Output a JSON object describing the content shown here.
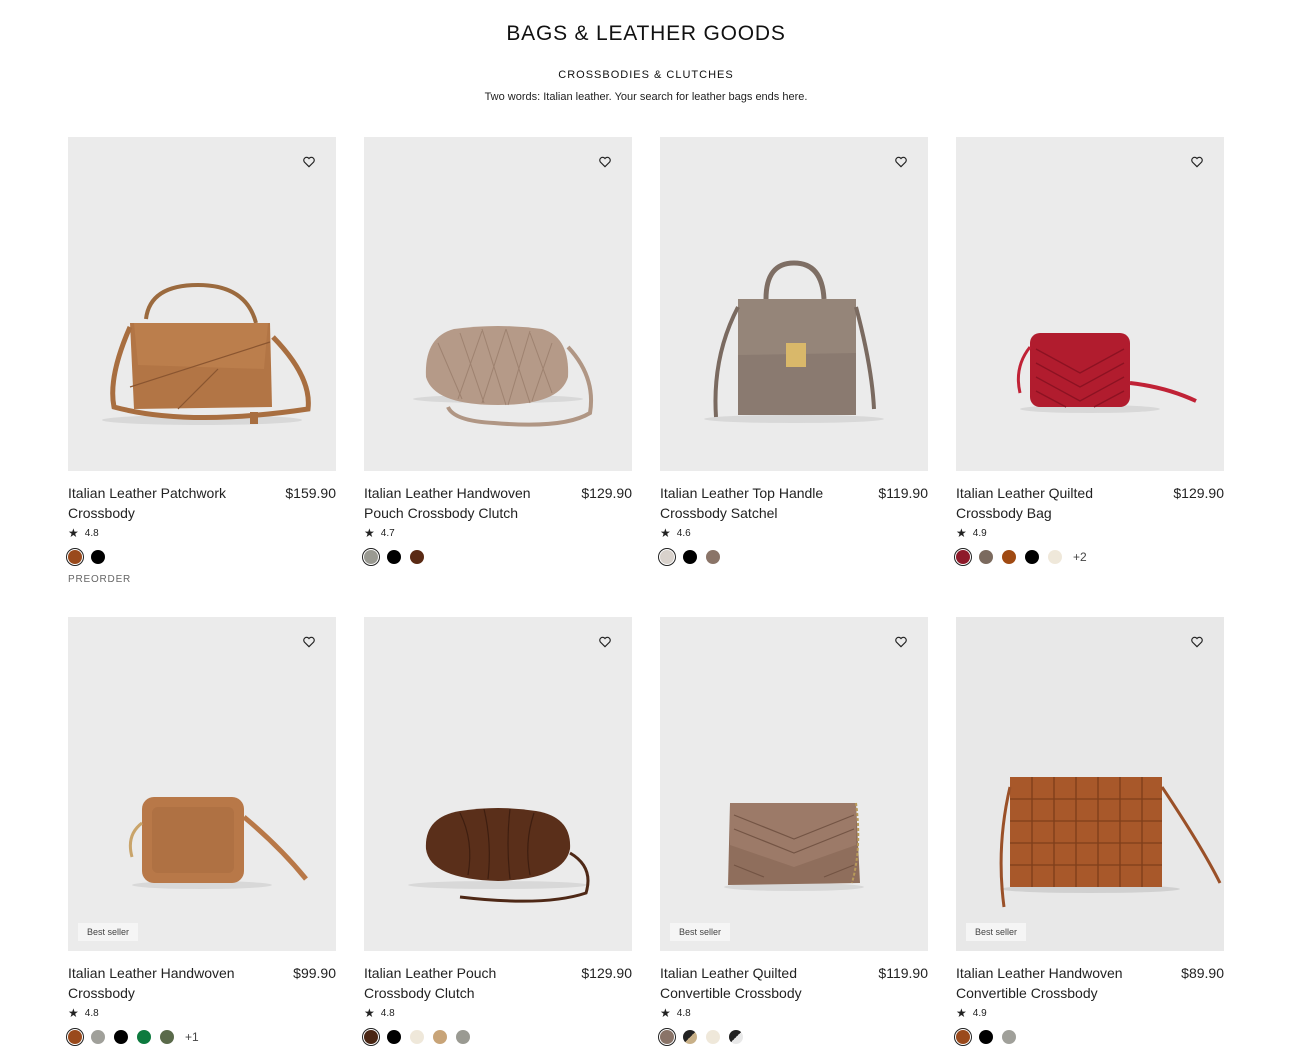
{
  "header": {
    "title": "BAGS & LEATHER GOODS",
    "subtitle": "CROSSBODIES & CLUTCHES",
    "description": "Two words: Italian leather. Your search for leather bags ends here."
  },
  "products": [
    {
      "name": "Italian Leather Patchwork Crossbody",
      "price": "$159.90",
      "rating": "4.8",
      "badge": "",
      "status": "PREORDER",
      "swatches": [
        "#9a4a1c",
        "#000000"
      ],
      "more": ""
    },
    {
      "name": "Italian Leather Handwoven Pouch Crossbody Clutch",
      "price": "$129.90",
      "rating": "4.7",
      "badge": "",
      "status": "",
      "swatches": [
        "#9a9a92",
        "#000000",
        "#5a2a14"
      ],
      "more": ""
    },
    {
      "name": "Italian Leather Top Handle Crossbody Satchel",
      "price": "$119.90",
      "rating": "4.6",
      "badge": "",
      "status": "",
      "swatches": [
        "#d9d2cc",
        "#000000",
        "#8a7468"
      ],
      "more": ""
    },
    {
      "name": "Italian Leather Quilted Crossbody Bag",
      "price": "$129.90",
      "rating": "4.9",
      "badge": "",
      "status": "",
      "swatches": [
        "#8e1a2a",
        "#7b6a5e",
        "#a04a12",
        "#000000",
        "#efe8da"
      ],
      "more": "+2"
    },
    {
      "name": "Italian Leather Handwoven Crossbody",
      "price": "$99.90",
      "rating": "4.8",
      "badge": "Best seller",
      "status": "",
      "swatches": [
        "#9a4a1c",
        "#a0a09a",
        "#000000",
        "#0d7a3e",
        "#5a6a4a"
      ],
      "more": "+1"
    },
    {
      "name": "Italian Leather Pouch Crossbody Clutch",
      "price": "$129.90",
      "rating": "4.8",
      "badge": "",
      "status": "",
      "swatches": [
        "#4a2614",
        "#000000",
        "#efe8da",
        "#c8a478",
        "#9a9a92"
      ],
      "more": ""
    },
    {
      "name": "Italian Leather Quilted Convertible Crossbody",
      "price": "$119.90",
      "rating": "4.8",
      "badge": "Best seller",
      "status": "",
      "swatches": [
        "#8a7468",
        "#c8b088",
        "#efe8da",
        "#222222"
      ],
      "more": ""
    },
    {
      "name": "Italian Leather Handwoven Convertible Crossbody",
      "price": "$89.90",
      "rating": "4.9",
      "badge": "Best seller",
      "status": "",
      "swatches": [
        "#9a4a1c",
        "#000000",
        "#a0a09a"
      ],
      "more": ""
    }
  ],
  "icons": {
    "wishlist": "heart-icon",
    "rating": "star-icon"
  }
}
